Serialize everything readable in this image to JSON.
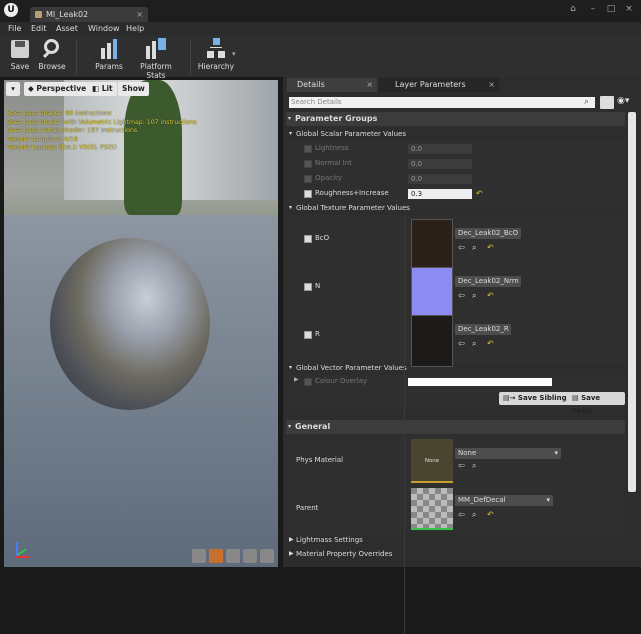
{
  "window": {
    "tab_title": "MI_Leak02",
    "menus": [
      "File",
      "Edit",
      "Asset",
      "Window",
      "Help"
    ]
  },
  "toolbar": {
    "buttons": [
      {
        "label": "Save",
        "icon": "save-icon"
      },
      {
        "label": "Browse",
        "icon": "browse-icon"
      },
      {
        "label": "Params",
        "icon": "params-icon"
      },
      {
        "label": "Platform Stats",
        "icon": "platform-stats-icon"
      },
      {
        "label": "Hierarchy",
        "icon": "hierarchy-icon"
      }
    ]
  },
  "viewport": {
    "perspective_label": "Perspective",
    "lit_label": "Lit",
    "show_label": "Show",
    "stats": [
      "Base pass shader: 80 instructions",
      "Base pass shader with Volumetric Lightmap: 107 instructions",
      "Base pass vertex shader: 197 instructions",
      "Texture samplers: 4/16",
      "Texture Lookups (Est.): VS(0), PS(5)"
    ]
  },
  "panels": {
    "details_tab": "Details",
    "layer_tab": "Layer Parameters",
    "search_placeholder": "Search Details"
  },
  "parameter_groups": {
    "title": "Parameter Groups",
    "scalar_title": "Global Scalar Parameter Values",
    "scalars": [
      {
        "name": "Lightness",
        "value": "0.0",
        "enabled": false
      },
      {
        "name": "Normal Int",
        "value": "0.0",
        "enabled": false
      },
      {
        "name": "Opacity",
        "value": "0.0",
        "enabled": false
      },
      {
        "name": "Roughness+Increase",
        "value": "0.3",
        "enabled": true
      }
    ],
    "texture_title": "Global Texture Parameter Values",
    "textures": [
      {
        "name": "BcO",
        "asset": "Dec_Leak02_BcO",
        "color": "#2b2118"
      },
      {
        "name": "N",
        "asset": "Dec_Leak02_Nrm",
        "color": "#8c8cf2"
      },
      {
        "name": "R",
        "asset": "Dec_Leak02_R",
        "color": "#1d1b19"
      }
    ],
    "vector_title": "Global Vector Parameter Values",
    "vector_name": "Colour Overlay",
    "save_sibling": "Save Sibling",
    "save_child": "Save Child"
  },
  "general": {
    "title": "General",
    "phys_label": "Phys Material",
    "phys_value": "None",
    "phys_thumb_label": "None",
    "parent_label": "Parent",
    "parent_value": "MM_DefDecal",
    "lightmass": "Lightmass Settings",
    "overrides": "Material Property Overrides"
  }
}
